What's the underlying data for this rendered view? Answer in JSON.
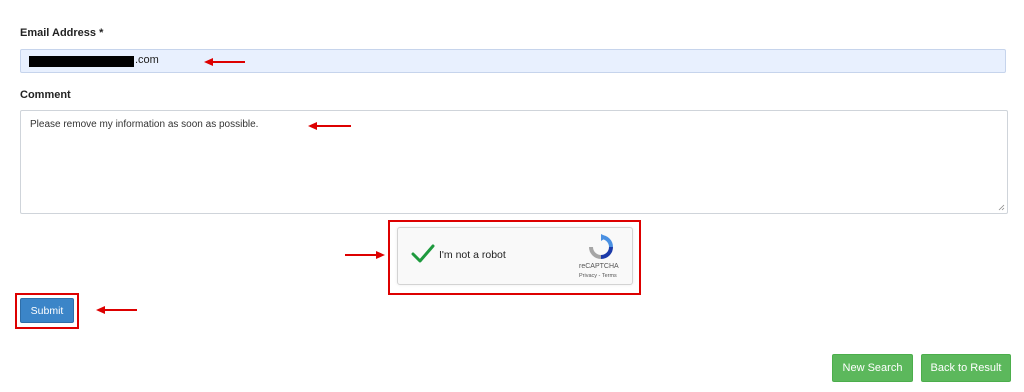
{
  "form": {
    "email_label": "Email Address *",
    "email_visible_suffix": ".com",
    "comment_label": "Comment",
    "comment_value": "Please remove my information as soon as possible.",
    "submit_label": "Submit"
  },
  "captcha": {
    "label": "I'm not a robot",
    "brand": "reCAPTCHA",
    "links": "Privacy - Terms",
    "checked": true
  },
  "actions": {
    "new_search_label": "New Search",
    "back_label": "Back to Result"
  },
  "colors": {
    "annotation": "#dd0000",
    "primary_button": "#3b85c8",
    "success_button": "#5cb85c",
    "autofill_field": "#e8f0fe"
  }
}
